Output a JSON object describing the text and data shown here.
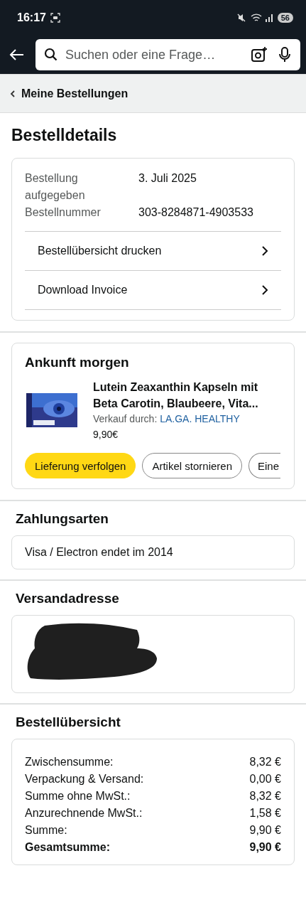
{
  "status_bar": {
    "time": "16:17",
    "battery": "56"
  },
  "search": {
    "placeholder": "Suchen oder eine Frage…"
  },
  "breadcrumb": {
    "label": "Meine Bestellungen"
  },
  "page_title": "Bestelldetails",
  "order_info": {
    "rows": [
      {
        "label": "Bestellung aufgegeben",
        "value": "3. Juli 2025"
      },
      {
        "label": "Bestellnummer",
        "value": "303-8284871-4903533"
      }
    ],
    "links": [
      {
        "label": "Bestellübersicht drucken"
      },
      {
        "label": "Download Invoice"
      }
    ]
  },
  "shipment": {
    "heading": "Ankunft morgen",
    "product": {
      "title": "Lutein Zeaxanthin Kapseln mit Beta Carotin, Blaubeere, Vita...",
      "seller_label": "Verkauf durch:",
      "seller": "LA.GA. HEALTHY",
      "price": "9,90€"
    },
    "actions": [
      {
        "label": "Lieferung verfolgen",
        "kind": "primary"
      },
      {
        "label": "Artikel stornieren",
        "kind": "secondary"
      },
      {
        "label": "Eine",
        "kind": "cut"
      }
    ]
  },
  "payment": {
    "heading": "Zahlungsarten",
    "method": "Visa / Electron endet im 2014"
  },
  "address": {
    "heading": "Versandadresse",
    "redacted": true
  },
  "summary": {
    "heading": "Bestellübersicht",
    "rows": [
      {
        "label": "Zwischensumme:",
        "value": "8,32 €",
        "kind": "line"
      },
      {
        "label": "Verpackung & Versand:",
        "value": "0,00 €",
        "kind": "line"
      },
      {
        "label": "Summe ohne MwSt.:",
        "value": "8,32 €",
        "kind": "line"
      },
      {
        "label": "Anzurechnende MwSt.:",
        "value": "1,58 €",
        "kind": "line"
      },
      {
        "label": "Summe:",
        "value": "9,90 €",
        "kind": "line"
      },
      {
        "label": "Gesamtsumme:",
        "value": "9,90 €",
        "kind": "total"
      }
    ]
  }
}
